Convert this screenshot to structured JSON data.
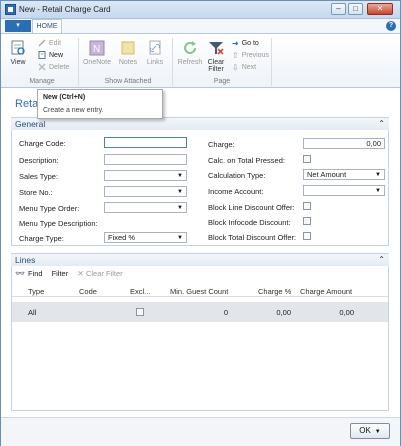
{
  "window": {
    "title": "New - Retail Charge Card",
    "controls": [
      "minimize",
      "maximize",
      "close"
    ]
  },
  "ribbon": {
    "tab": "HOME",
    "groups": {
      "manage": {
        "label": "Manage",
        "view": "View",
        "edit": "Edit",
        "new": "New",
        "delete": "Delete"
      },
      "show_attached": {
        "label": "Show Attached",
        "onenote": "OneNote",
        "notes": "Notes",
        "links": "Links"
      },
      "page": {
        "label": "Page",
        "refresh": "Refresh",
        "clear_filter_1": "Clear",
        "clear_filter_2": "Filter",
        "goto": "Go to",
        "previous": "Previous",
        "next": "Next"
      }
    }
  },
  "tooltip": {
    "title": "New (Ctrl+N)",
    "body": "Create a new entry."
  },
  "page_title": "Retai",
  "general": {
    "header": "General",
    "left": {
      "charge_code": {
        "label": "Charge Code:",
        "value": ""
      },
      "description": {
        "label": "Description:",
        "value": ""
      },
      "sales_type": {
        "label": "Sales Type:",
        "value": ""
      },
      "store_no": {
        "label": "Store No.:",
        "value": ""
      },
      "menu_type_order": {
        "label": "Menu Type Order:",
        "value": ""
      },
      "menu_type_description": {
        "label": "Menu Type Description:",
        "value": ""
      },
      "charge_type": {
        "label": "Charge Type:",
        "value": "Fixed %"
      }
    },
    "right": {
      "charge": {
        "label": "Charge:",
        "value": "0,00"
      },
      "calc_on_total": {
        "label": "Calc. on Total Pressed:",
        "checked": false
      },
      "calculation_type": {
        "label": "Calculation Type:",
        "value": "Net Amount"
      },
      "income_account": {
        "label": "Income Account:",
        "value": ""
      },
      "block_line_discount": {
        "label": "Block Line Discount Offer:",
        "checked": false
      },
      "block_infocode_discount": {
        "label": "Block Infocode Discount:",
        "checked": false
      },
      "block_total_discount": {
        "label": "Block Total Discount Offer:",
        "checked": false
      }
    }
  },
  "lines": {
    "header": "Lines",
    "toolbar": {
      "find": "Find",
      "filter": "Filter",
      "clear_filter": "Clear Filter"
    },
    "columns": [
      "Type",
      "Code",
      "Excl...",
      "Min. Guest Count",
      "Charge %",
      "Charge Amount"
    ],
    "rows": [
      {
        "type": "All",
        "code": "",
        "excl": false,
        "min_guest_count": "0",
        "charge_pct": "0,00",
        "charge_amount": "0,00"
      }
    ]
  },
  "footer": {
    "ok": "OK"
  },
  "colors": {
    "accent": "#2a6fb6",
    "header_bg": "#e3ebf3",
    "selected_row": "#e2e6ea"
  }
}
